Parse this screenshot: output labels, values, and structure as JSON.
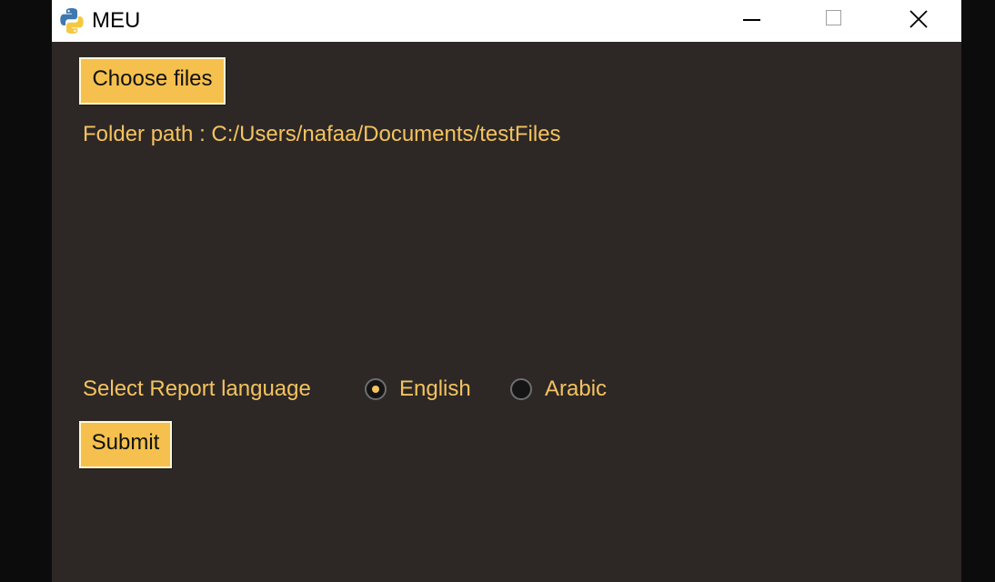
{
  "window": {
    "title": "MEU"
  },
  "controls": {
    "choose_files_label": "Choose files",
    "folder_path_text": "Folder path : C:/Users/nafaa/Documents/testFiles",
    "language_label": "Select Report language",
    "language_options": [
      {
        "label": "English",
        "selected": true
      },
      {
        "label": "Arabic",
        "selected": false
      }
    ],
    "submit_label": "Submit"
  },
  "colors": {
    "background": "#2d2826",
    "accent": "#f4c35f",
    "button": "#f5c04e"
  }
}
